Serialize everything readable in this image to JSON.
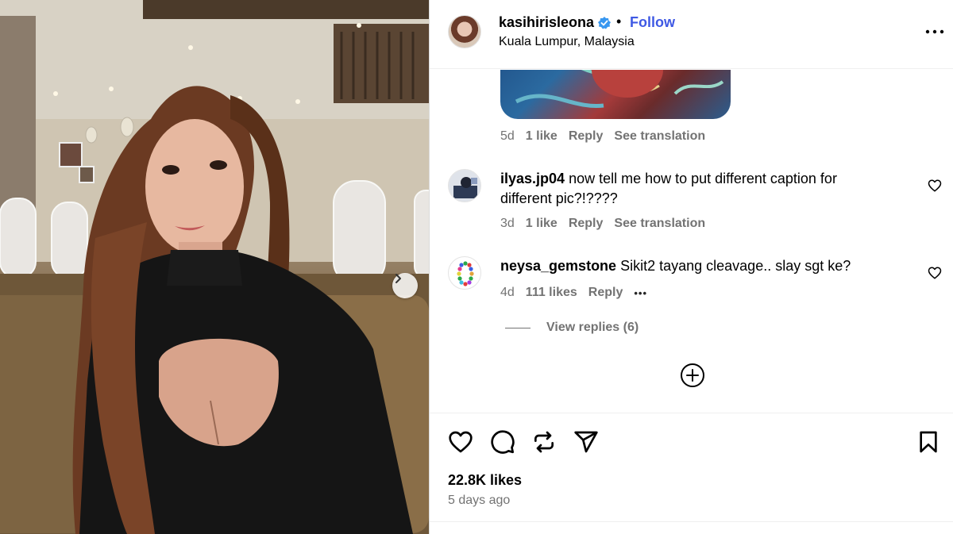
{
  "post": {
    "username": "kasihirisleona",
    "follow_label": "Follow",
    "dot_separator": "•",
    "location": "Kuala Lumpur, Malaysia"
  },
  "comments": [
    {
      "time": "5d",
      "likes": "1 like",
      "reply_label": "Reply",
      "translation_label": "See translation"
    },
    {
      "username": "ilyas.jp04",
      "text": "now tell me how to put different caption for different pic?!????",
      "time": "3d",
      "likes": "1 like",
      "reply_label": "Reply",
      "translation_label": "See translation"
    },
    {
      "username": "neysa_gemstone",
      "text": "Sikit2 tayang cleavage.. slay sgt ke?",
      "time": "4d",
      "likes": "111 likes",
      "reply_label": "Reply",
      "more_label": "•••",
      "view_replies_label": "View replies (6)"
    }
  ],
  "footer": {
    "likes_count": "22.8K likes",
    "posted_ago": "5 days ago"
  },
  "icons": {
    "verified": "verified-badge-icon",
    "more": "more-options-icon",
    "like": "heart-icon",
    "comment": "comment-icon",
    "repost": "repost-icon",
    "share": "share-icon",
    "save": "bookmark-icon",
    "load_more": "plus-circle-icon",
    "next": "chevron-right-icon"
  },
  "colors": {
    "accent": "#3f59e4",
    "secondary_text": "#737373",
    "verified": "#3897f0",
    "divider": "#efefef"
  }
}
